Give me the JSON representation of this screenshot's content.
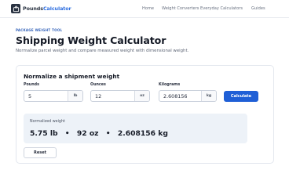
{
  "brand": {
    "name_dark": "Pounds",
    "name_accent": "Calculator",
    "icon": "scale-icon"
  },
  "nav": {
    "items": [
      "Home",
      "Weight Converters",
      "Everyday Calculators",
      "Guides"
    ]
  },
  "hero": {
    "eyebrow": "PACKAGE WEIGHT TOOL",
    "title": "Shipping Weight Calculator",
    "subtitle": "Normalize parcel weight and compare measured weight with dimensional weight."
  },
  "form": {
    "title": "Normalize a shipment weight",
    "pounds": {
      "label": "Pounds",
      "value": "5",
      "unit": "lb"
    },
    "ounces": {
      "label": "Ounces",
      "value": "12",
      "unit": "oz"
    },
    "kilograms": {
      "label": "Kilograms",
      "value": "2.608156",
      "unit": "kg"
    },
    "calculate_label": "Calculate",
    "reset_label": "Reset"
  },
  "result": {
    "label": "Normalized weight",
    "lb": "5.75 lb",
    "oz": "92 oz",
    "kg": "2.608156 kg",
    "separator": "•"
  },
  "colors": {
    "accent": "#1f5fd6",
    "brand_dark": "#2a3342",
    "brand_accent": "#2f6fe0",
    "result_bg": "#edf2f8"
  }
}
